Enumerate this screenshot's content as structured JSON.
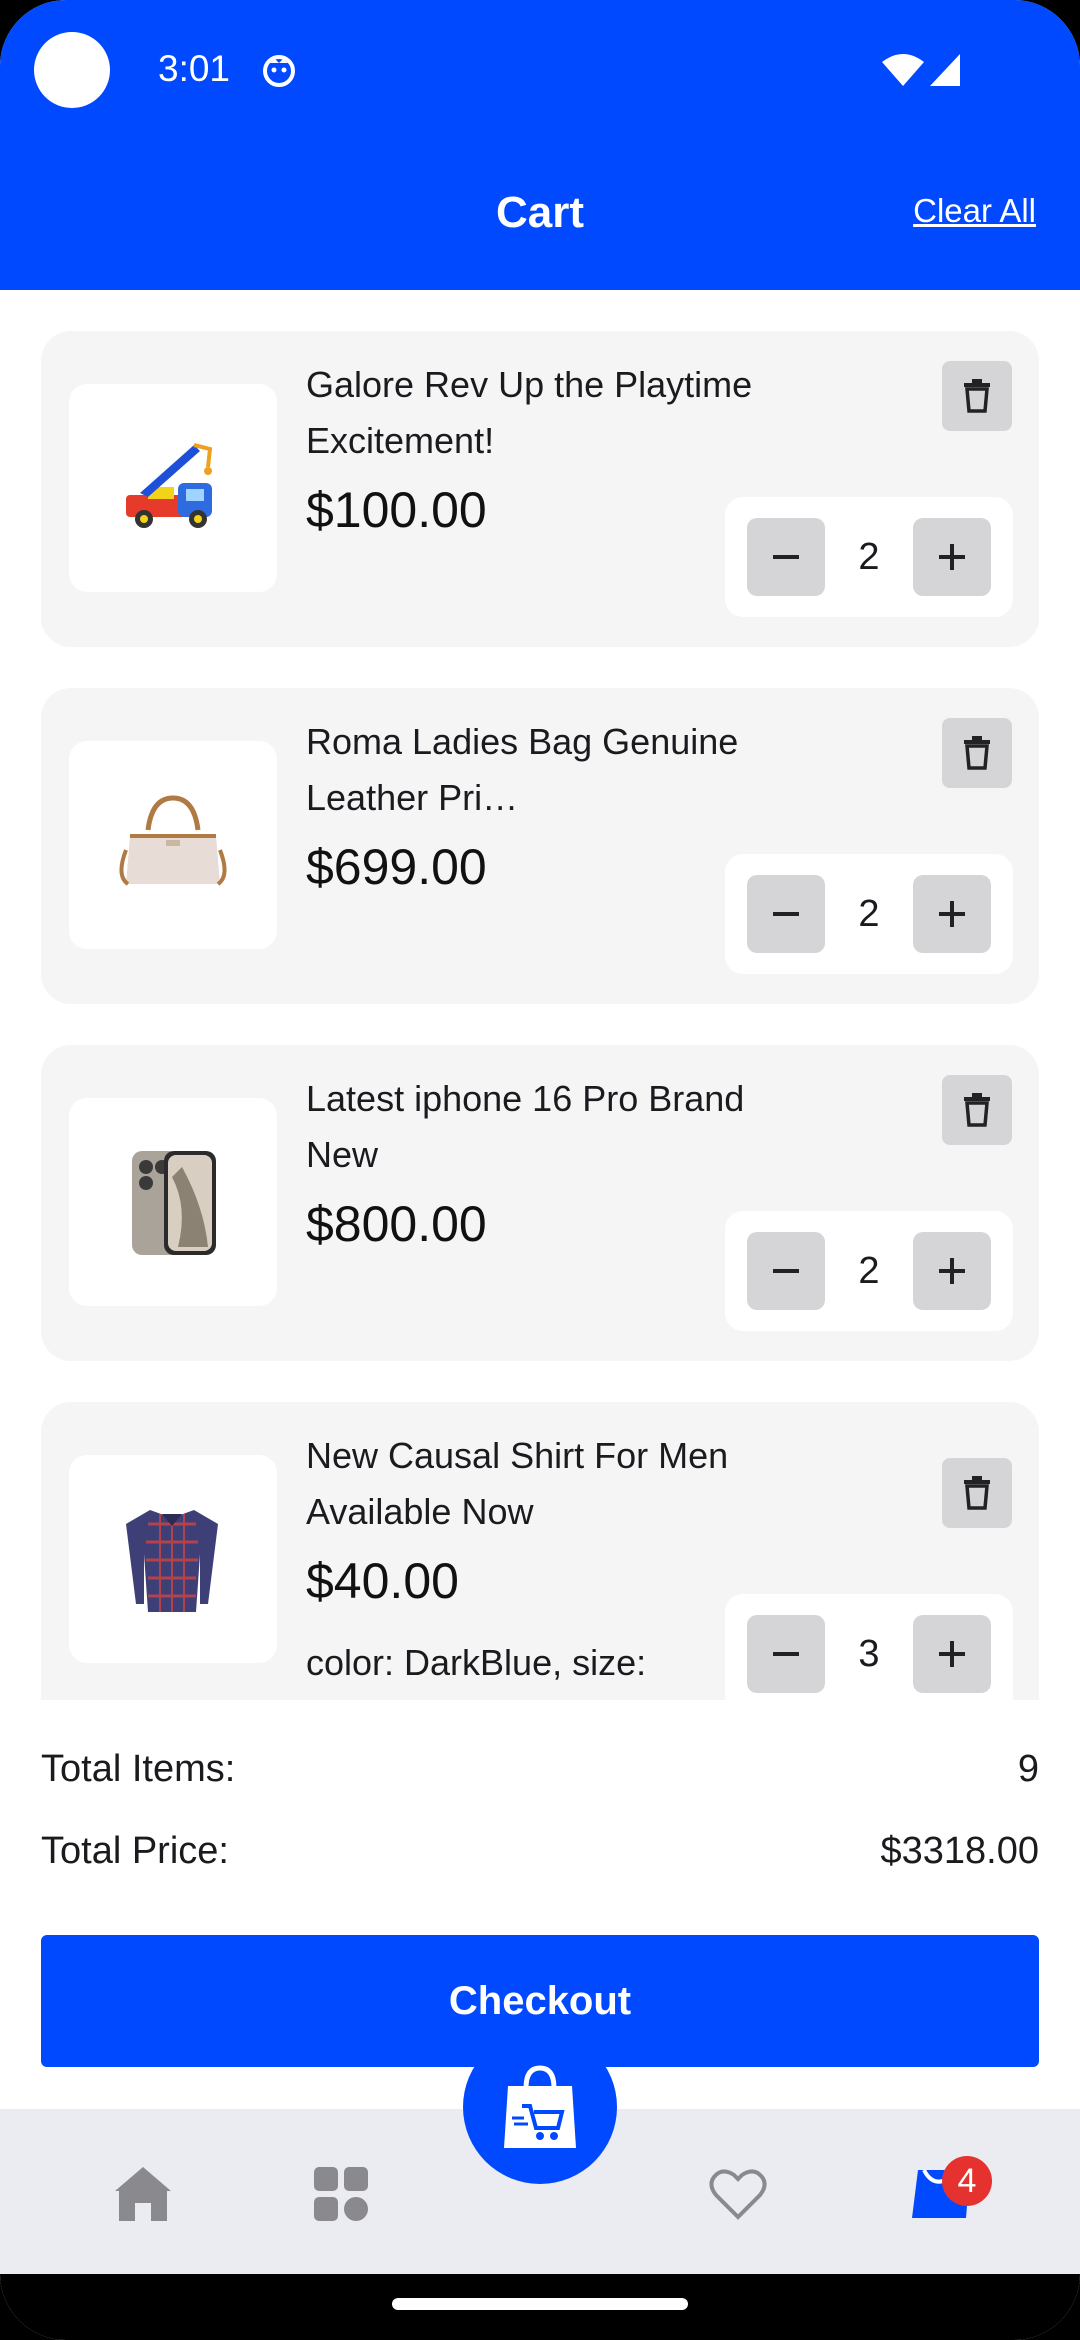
{
  "status_bar": {
    "time": "3:01"
  },
  "app_bar": {
    "title": "Cart",
    "clear_all_label": "Clear All"
  },
  "cart_items": [
    {
      "name": "Galore Rev Up the Playtime  Excitement!",
      "price": "$100.00",
      "quantity": "2",
      "icon": "toy-truck-image"
    },
    {
      "name": "Roma Ladies  Bag Genuine Leather Pri…",
      "price": "$699.00",
      "quantity": "2",
      "icon": "handbag-image"
    },
    {
      "name": "Latest iphone 16 Pro Brand New",
      "price": "$800.00",
      "quantity": "2",
      "icon": "phone-image"
    },
    {
      "name": "New Causal Shirt For Men Available Now",
      "price": "$40.00",
      "quantity": "3",
      "variant": "color: DarkBlue, size:",
      "icon": "shirt-image"
    }
  ],
  "summary": {
    "total_items_label": "Total Items:",
    "total_items_value": "9",
    "total_price_label": "Total Price:",
    "total_price_value": "$3318.00"
  },
  "checkout_label": "Checkout",
  "bottom_nav": {
    "items": [
      "home-icon",
      "categories-icon",
      "shop-bag-icon",
      "heart-icon",
      "cart-icon"
    ],
    "cart_badge": "4"
  },
  "colors": {
    "primary": "#0049ff",
    "card_bg": "#f5f5f6",
    "button_gray": "#d5d5d8",
    "badge": "#e5322f",
    "nav_bg": "#ebebf2"
  }
}
